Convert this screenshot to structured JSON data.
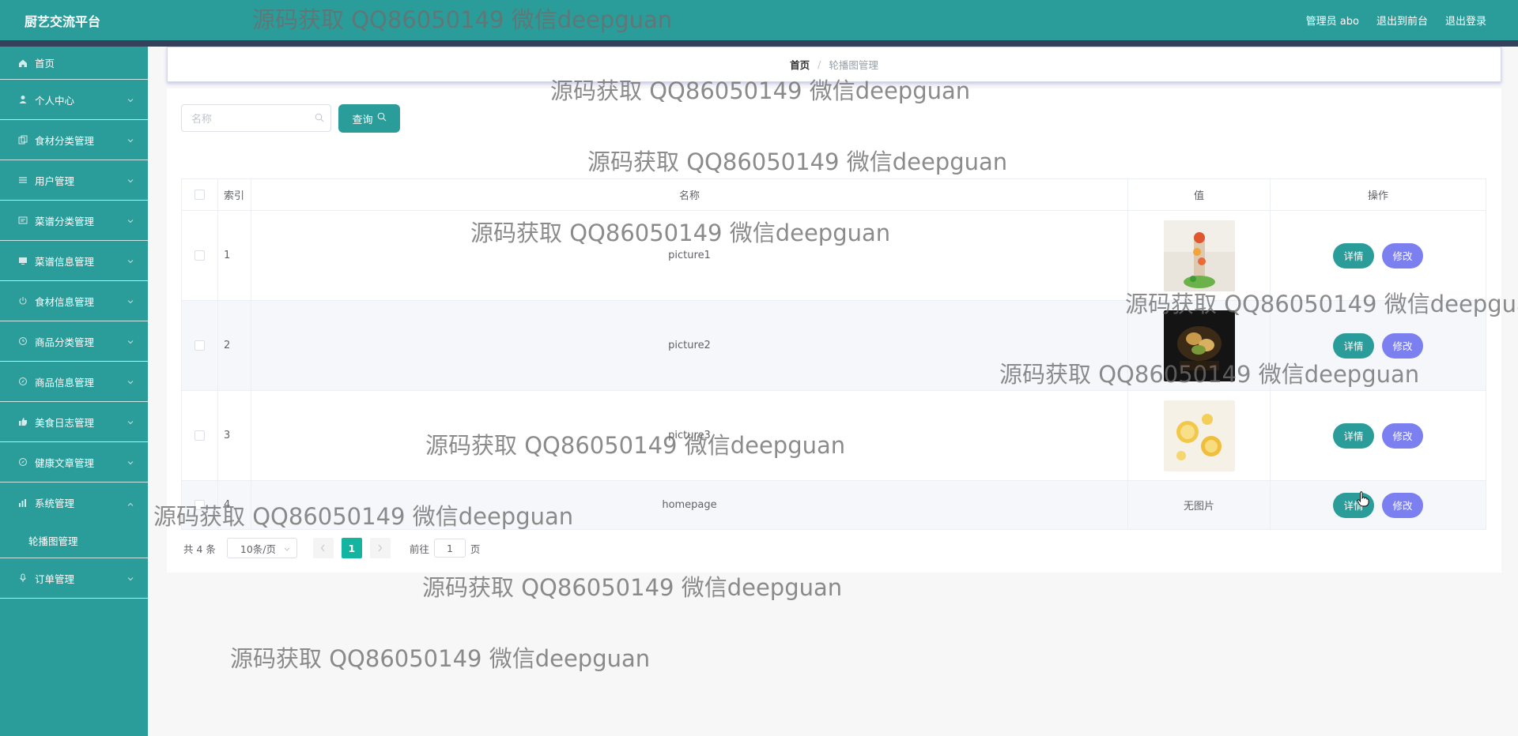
{
  "header": {
    "brand": "厨艺交流平台",
    "user_label": "管理员 abo",
    "to_front": "退出到前台",
    "logout": "退出登录"
  },
  "sidebar": {
    "items": [
      {
        "label": "首页",
        "icon": "home-icon"
      },
      {
        "label": "个人中心",
        "icon": "user-icon"
      },
      {
        "label": "食材分类管理",
        "icon": "copy-icon"
      },
      {
        "label": "用户管理",
        "icon": "list-icon"
      },
      {
        "label": "菜谱分类管理",
        "icon": "message-icon"
      },
      {
        "label": "菜谱信息管理",
        "icon": "monitor-icon"
      },
      {
        "label": "食材信息管理",
        "icon": "power-icon"
      },
      {
        "label": "商品分类管理",
        "icon": "clock-icon"
      },
      {
        "label": "商品信息管理",
        "icon": "compass-icon"
      },
      {
        "label": "美食日志管理",
        "icon": "thumb-icon"
      },
      {
        "label": "健康文章管理",
        "icon": "compass-icon"
      },
      {
        "label": "系统管理",
        "icon": "chart-icon"
      },
      {
        "label": "订单管理",
        "icon": "mic-icon"
      }
    ],
    "sub_item": "轮播图管理"
  },
  "breadcrumb": {
    "home": "首页",
    "sep": "/",
    "current": "轮播图管理"
  },
  "search": {
    "placeholder": "名称",
    "button": "查询"
  },
  "table": {
    "headers": [
      "索引",
      "名称",
      "值",
      "操作"
    ],
    "rows": [
      {
        "index": "1",
        "name": "picture1",
        "value": "",
        "image": "dessert"
      },
      {
        "index": "2",
        "name": "picture2",
        "value": "",
        "image": "dark-food"
      },
      {
        "index": "3",
        "name": "picture3",
        "value": "",
        "image": "citrus"
      },
      {
        "index": "4",
        "name": "homepage",
        "value": "无图片",
        "image": ""
      }
    ],
    "detail_label": "详情",
    "edit_label": "修改"
  },
  "pagination": {
    "total": "共 4 条",
    "page_size": "10条/页",
    "current_page": "1",
    "goto_label": "前往",
    "goto_value": "1",
    "page_unit": "页"
  },
  "watermark": "源码获取 QQ86050149 微信deepguan",
  "colors": {
    "primary": "#2a9d9a",
    "edit": "#7b7ff0",
    "active_page": "#13b5a0"
  }
}
